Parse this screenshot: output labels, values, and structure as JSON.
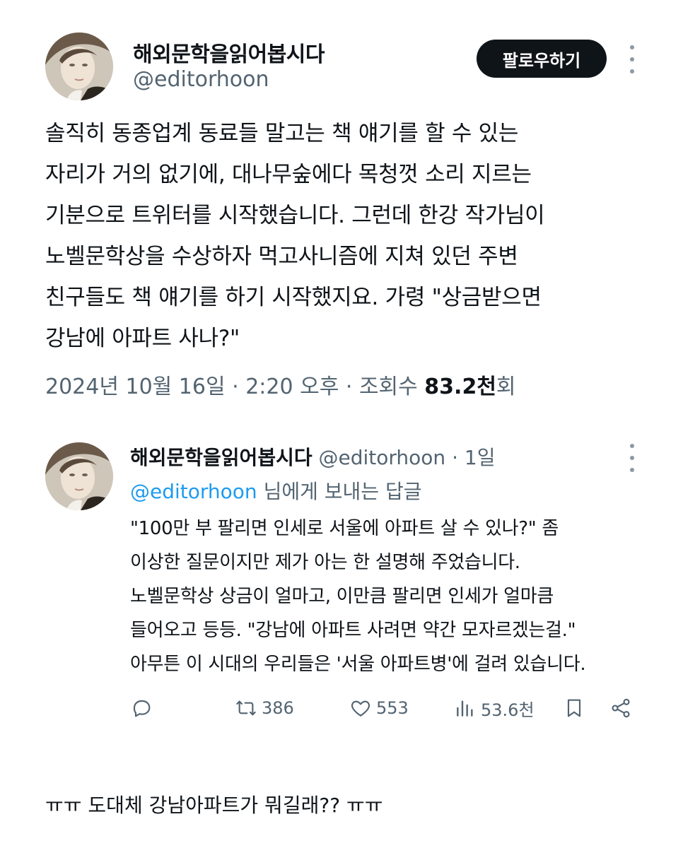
{
  "main_tweet": {
    "display_name": "해외문학을읽어봅시다",
    "handle": "@editorhoon",
    "follow_label": "팔로우하기",
    "text_lines": [
      "솔직히 동종업계 동료들 말고는 책 얘기를 할 수 있는",
      "자리가 거의 없기에, 대나무숲에다 목청껏 소리 지르는",
      "기분으로 트위터를 시작했습니다. 그런데 한강 작가님이",
      "노벨문학상을 수상하자 먹고사니즘에 지쳐 있던 주변",
      "친구들도 책 얘기를 하기 시작했지요. 가령 \"상금받으면",
      "강남에 아파트 사나?\""
    ],
    "date": "2024년 10월 16일",
    "time": "2:20 오후",
    "views_label": "조회수",
    "views_number": "83.2천",
    "views_suffix": "회"
  },
  "reply": {
    "display_name": "해외문학을읽어봅시다",
    "handle": "@editorhoon",
    "age": "1일",
    "replying_handle": "@editorhoon",
    "replying_suffix": "님에게 보내는 답글",
    "text_lines": [
      "\"100만 부 팔리면 인세로 서울에 아파트 살 수 있나?\" 좀",
      "이상한 질문이지만 제가 아는 한 설명해 주었습니다.",
      "노벨문학상 상금이 얼마고, 이만큼 팔리면 인세가 얼마큼",
      "들어오고 등등. \"강남에 아파트 사려면 약간 모자르겠는걸.\"",
      "아무튼 이 시대의 우리들은 '서울 아파트병'에 걸려 있습니다."
    ],
    "retweets": "386",
    "likes": "553",
    "views": "53.6천"
  },
  "bottom_comment": "ㅠㅠ 도대체 강남아파트가 뭐길래?? ㅠㅠ",
  "icons": {
    "reply": "reply-icon",
    "retweet": "retweet-icon",
    "like": "heart-icon",
    "views": "views-icon",
    "bookmark": "bookmark-icon",
    "share": "share-icon",
    "more": "more-dots-icon"
  },
  "colors": {
    "text": "#0f1419",
    "muted": "#536471",
    "link": "#1d9bf0",
    "button_bg": "#0f1419"
  }
}
